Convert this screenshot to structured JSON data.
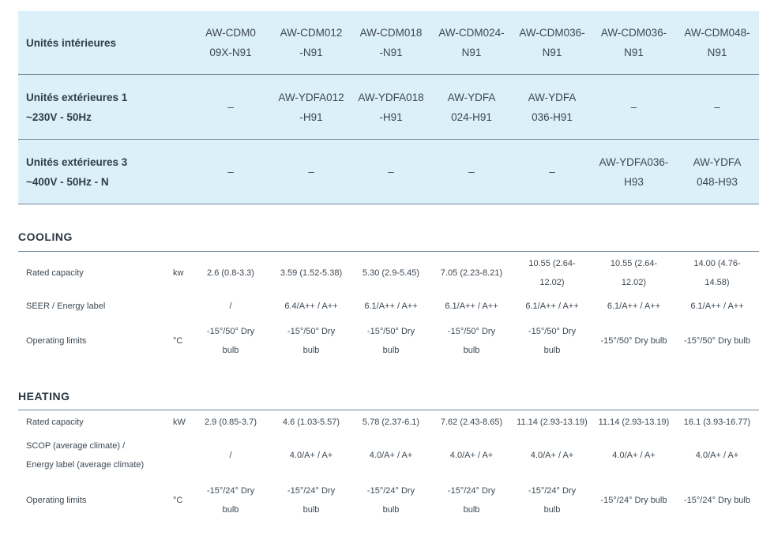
{
  "models": {
    "indoor_label": "Unités intérieures",
    "indoor_units": [
      "AW-CDM009X-N91",
      "AW-CDM012-N91",
      "AW-CDM018-N91",
      "AW-CDM024-N91",
      "AW-CDM036-N91",
      "AW-CDM036-N91",
      "AW-CDM048-N91"
    ],
    "outdoor1_label_line1": "Unités extérieures 1",
    "outdoor1_label_line2": "~230V - 50Hz",
    "outdoor1_units": [
      "–",
      "AW-YDFA012-H91",
      "AW-YDFA018-H91",
      "AW-YDFA024-H91",
      "AW-YDFA036-H91",
      "–",
      "–"
    ],
    "outdoor3_label_line1": "Unités extérieures 3",
    "outdoor3_label_line2": "~400V - 50Hz - N",
    "outdoor3_units": [
      "–",
      "–",
      "–",
      "–",
      "–",
      "AW-YDFA036-H93",
      "AW-YDFA048-H93"
    ]
  },
  "cooling": {
    "title": "COOLING",
    "rows": [
      {
        "label": "Rated capacity",
        "unit": "kw",
        "values": [
          "2.6 (0.8-3.3)",
          "3.59 (1.52-5.38)",
          "5.30 (2.9-5.45)",
          "7.05 (2.23-8.21)",
          "10.55 (2.64-12.02)",
          "10.55 (2.64-12.02)",
          "14.00 (4.76-14.58)"
        ]
      },
      {
        "label": "SEER / Energy label",
        "unit": "",
        "values": [
          "/",
          "6.4/A++ / A++",
          "6.1/A++ / A++",
          "6.1/A++ / A++",
          "6.1/A++ / A++",
          "6.1/A++ / A++",
          "6.1/A++ / A++"
        ]
      },
      {
        "label": "Operating limits",
        "unit": "°C",
        "values": [
          "-15°/50° Dry bulb",
          "-15°/50° Dry bulb",
          "-15°/50° Dry bulb",
          "-15°/50° Dry bulb",
          "-15°/50° Dry bulb",
          "-15°/50° Dry bulb",
          "-15°/50° Dry bulb"
        ]
      }
    ]
  },
  "heating": {
    "title": "HEATING",
    "rows": [
      {
        "label": "Rated capacity",
        "unit": "kW",
        "values": [
          "2.9 (0.85-3.7)",
          "4.6 (1.03-5.57)",
          "5.78 (2.37-6.1)",
          "7.62 (2.43-8.65)",
          "11.14 (2.93-13.19)",
          "11.14 (2.93-13.19)",
          "16.1 (3.93-16.77)"
        ]
      },
      {
        "label": "SCOP (average climate) / Energy label (average climate)",
        "unit": "",
        "values": [
          "/",
          "4.0/A+ / A+",
          "4.0/A+ / A+",
          "4.0/A+ / A+",
          "4.0/A+ / A+",
          "4.0/A+ / A+",
          "4.0/A+ / A+"
        ]
      },
      {
        "label": "Operating limits",
        "unit": "°C",
        "values": [
          "-15°/24° Dry bulb",
          "-15°/24° Dry bulb",
          "-15°/24° Dry bulb",
          "-15°/24° Dry bulb",
          "-15°/24° Dry bulb",
          "-15°/24° Dry bulb",
          "-15°/24° Dry bulb"
        ]
      }
    ]
  }
}
